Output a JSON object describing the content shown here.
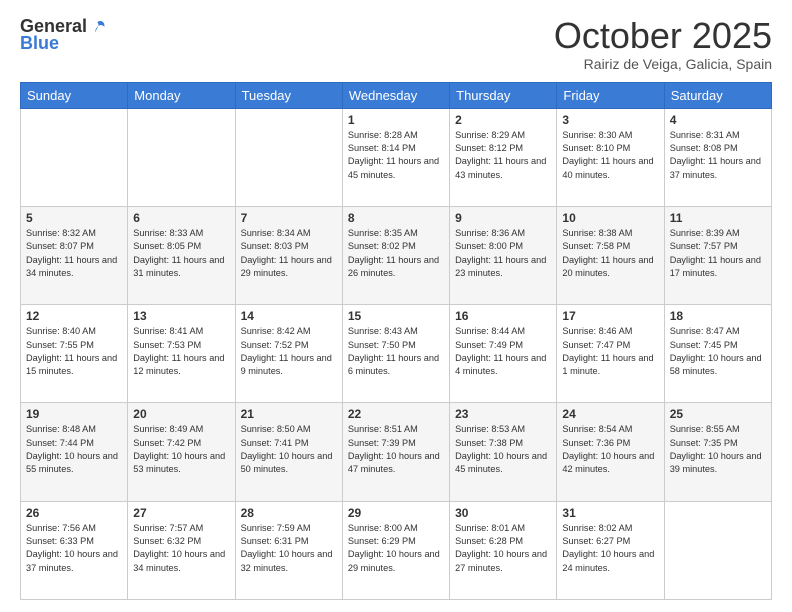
{
  "header": {
    "logo_general": "General",
    "logo_blue": "Blue",
    "month_title": "October 2025",
    "location": "Rairiz de Veiga, Galicia, Spain"
  },
  "days_of_week": [
    "Sunday",
    "Monday",
    "Tuesday",
    "Wednesday",
    "Thursday",
    "Friday",
    "Saturday"
  ],
  "weeks": [
    [
      {
        "day": "",
        "sunrise": "",
        "sunset": "",
        "daylight": ""
      },
      {
        "day": "",
        "sunrise": "",
        "sunset": "",
        "daylight": ""
      },
      {
        "day": "",
        "sunrise": "",
        "sunset": "",
        "daylight": ""
      },
      {
        "day": "1",
        "sunrise": "8:28 AM",
        "sunset": "8:14 PM",
        "daylight": "11 hours and 45 minutes."
      },
      {
        "day": "2",
        "sunrise": "8:29 AM",
        "sunset": "8:12 PM",
        "daylight": "11 hours and 43 minutes."
      },
      {
        "day": "3",
        "sunrise": "8:30 AM",
        "sunset": "8:10 PM",
        "daylight": "11 hours and 40 minutes."
      },
      {
        "day": "4",
        "sunrise": "8:31 AM",
        "sunset": "8:08 PM",
        "daylight": "11 hours and 37 minutes."
      }
    ],
    [
      {
        "day": "5",
        "sunrise": "8:32 AM",
        "sunset": "8:07 PM",
        "daylight": "11 hours and 34 minutes."
      },
      {
        "day": "6",
        "sunrise": "8:33 AM",
        "sunset": "8:05 PM",
        "daylight": "11 hours and 31 minutes."
      },
      {
        "day": "7",
        "sunrise": "8:34 AM",
        "sunset": "8:03 PM",
        "daylight": "11 hours and 29 minutes."
      },
      {
        "day": "8",
        "sunrise": "8:35 AM",
        "sunset": "8:02 PM",
        "daylight": "11 hours and 26 minutes."
      },
      {
        "day": "9",
        "sunrise": "8:36 AM",
        "sunset": "8:00 PM",
        "daylight": "11 hours and 23 minutes."
      },
      {
        "day": "10",
        "sunrise": "8:38 AM",
        "sunset": "7:58 PM",
        "daylight": "11 hours and 20 minutes."
      },
      {
        "day": "11",
        "sunrise": "8:39 AM",
        "sunset": "7:57 PM",
        "daylight": "11 hours and 17 minutes."
      }
    ],
    [
      {
        "day": "12",
        "sunrise": "8:40 AM",
        "sunset": "7:55 PM",
        "daylight": "11 hours and 15 minutes."
      },
      {
        "day": "13",
        "sunrise": "8:41 AM",
        "sunset": "7:53 PM",
        "daylight": "11 hours and 12 minutes."
      },
      {
        "day": "14",
        "sunrise": "8:42 AM",
        "sunset": "7:52 PM",
        "daylight": "11 hours and 9 minutes."
      },
      {
        "day": "15",
        "sunrise": "8:43 AM",
        "sunset": "7:50 PM",
        "daylight": "11 hours and 6 minutes."
      },
      {
        "day": "16",
        "sunrise": "8:44 AM",
        "sunset": "7:49 PM",
        "daylight": "11 hours and 4 minutes."
      },
      {
        "day": "17",
        "sunrise": "8:46 AM",
        "sunset": "7:47 PM",
        "daylight": "11 hours and 1 minute."
      },
      {
        "day": "18",
        "sunrise": "8:47 AM",
        "sunset": "7:45 PM",
        "daylight": "10 hours and 58 minutes."
      }
    ],
    [
      {
        "day": "19",
        "sunrise": "8:48 AM",
        "sunset": "7:44 PM",
        "daylight": "10 hours and 55 minutes."
      },
      {
        "day": "20",
        "sunrise": "8:49 AM",
        "sunset": "7:42 PM",
        "daylight": "10 hours and 53 minutes."
      },
      {
        "day": "21",
        "sunrise": "8:50 AM",
        "sunset": "7:41 PM",
        "daylight": "10 hours and 50 minutes."
      },
      {
        "day": "22",
        "sunrise": "8:51 AM",
        "sunset": "7:39 PM",
        "daylight": "10 hours and 47 minutes."
      },
      {
        "day": "23",
        "sunrise": "8:53 AM",
        "sunset": "7:38 PM",
        "daylight": "10 hours and 45 minutes."
      },
      {
        "day": "24",
        "sunrise": "8:54 AM",
        "sunset": "7:36 PM",
        "daylight": "10 hours and 42 minutes."
      },
      {
        "day": "25",
        "sunrise": "8:55 AM",
        "sunset": "7:35 PM",
        "daylight": "10 hours and 39 minutes."
      }
    ],
    [
      {
        "day": "26",
        "sunrise": "7:56 AM",
        "sunset": "6:33 PM",
        "daylight": "10 hours and 37 minutes."
      },
      {
        "day": "27",
        "sunrise": "7:57 AM",
        "sunset": "6:32 PM",
        "daylight": "10 hours and 34 minutes."
      },
      {
        "day": "28",
        "sunrise": "7:59 AM",
        "sunset": "6:31 PM",
        "daylight": "10 hours and 32 minutes."
      },
      {
        "day": "29",
        "sunrise": "8:00 AM",
        "sunset": "6:29 PM",
        "daylight": "10 hours and 29 minutes."
      },
      {
        "day": "30",
        "sunrise": "8:01 AM",
        "sunset": "6:28 PM",
        "daylight": "10 hours and 27 minutes."
      },
      {
        "day": "31",
        "sunrise": "8:02 AM",
        "sunset": "6:27 PM",
        "daylight": "10 hours and 24 minutes."
      },
      {
        "day": "",
        "sunrise": "",
        "sunset": "",
        "daylight": ""
      }
    ]
  ]
}
